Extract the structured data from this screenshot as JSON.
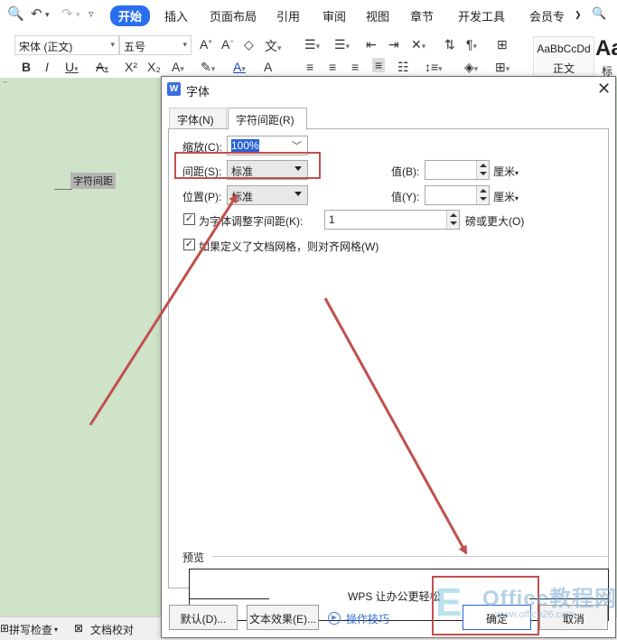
{
  "ribbon": {
    "tabs": [
      "开始",
      "插入",
      "页面布局",
      "引用",
      "审阅",
      "视图",
      "章节",
      "开发工具",
      "会员专"
    ],
    "font_name": "宋体 (正文)",
    "font_size": "五号",
    "style_preview": "AaBbCcDd",
    "style_name": "正文",
    "style_big": "Aa",
    "style_big_name": "标"
  },
  "document": {
    "selected_text": "字符间距"
  },
  "statusbar": {
    "spell_check": "拼写检查",
    "doc_proof": "文档校对"
  },
  "dialog": {
    "title": "字体",
    "tabs": {
      "font": "字体(N)",
      "spacing": "字符间距(R)"
    },
    "scale_label": "缩放(C):",
    "scale_value": "100%",
    "spacing_label": "间距(S):",
    "spacing_value": "标准",
    "spacing_amount_label": "值(B):",
    "spacing_amount_value": "",
    "spacing_unit": "厘米",
    "position_label": "位置(P):",
    "position_value": "标准",
    "position_amount_label": "值(Y):",
    "position_amount_value": "",
    "position_unit": "厘米",
    "kerning_label": "为字体调整字间距(K):",
    "kerning_value": "1",
    "kerning_suffix": "磅或更大(O)",
    "grid_label": "如果定义了文档网格，则对齐网格(W)",
    "preview_label": "预览",
    "preview_text": "WPS 让办公更轻松",
    "buttons": {
      "default": "默认(D)...",
      "text_effect": "文本效果(E)...",
      "tips": "操作技巧",
      "ok": "确定",
      "cancel": "取消"
    }
  },
  "watermark": {
    "text": "Office教程网",
    "sub": "www.office26.com"
  },
  "colors": {
    "accent": "#2a6ef0",
    "annotation": "#c0504d",
    "doc_background": "#cfe3c8"
  }
}
